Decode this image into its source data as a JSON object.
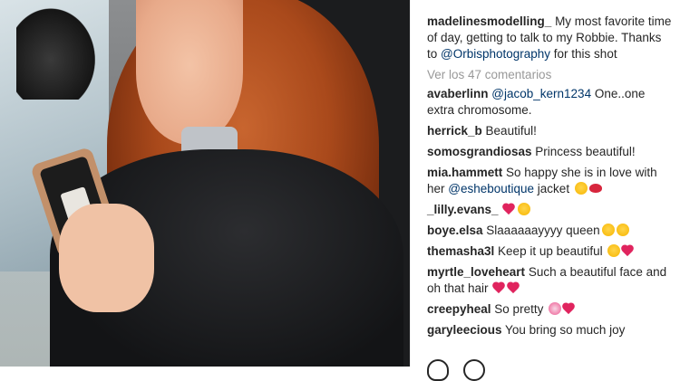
{
  "post": {
    "author": "madelinesmodelling_",
    "caption_pre": "My most favorite time of day, getting to talk to my Robbie. Thanks to ",
    "caption_mention": "@Orbisphotography",
    "caption_post": " for this shot"
  },
  "view_all_comments": "Ver los 47 comentarios",
  "comments": [
    {
      "user": "avaberlinn",
      "mention": "@jacob_kern1234",
      "text": " One..one extra chromosome.",
      "emojis": []
    },
    {
      "user": "herrick_b",
      "mention": "",
      "text": " Beautiful!",
      "emojis": []
    },
    {
      "user": "somosgrandiosas",
      "mention": "",
      "text": " Princess beautiful!",
      "emojis": []
    },
    {
      "user": "mia.hammett",
      "mention_prefix": " So happy she is in love with her ",
      "mention": "@esheboutique",
      "text": " jacket",
      "emojis": [
        "face-kiss",
        "lips"
      ]
    },
    {
      "user": "_lilly.evans_",
      "mention": "",
      "text": "",
      "emojis": [
        "heart",
        "face-heart"
      ]
    },
    {
      "user": "boye.elsa",
      "mention": "",
      "text": " Slaaaaaayyyy queen",
      "emojis": [
        "face-heart",
        "face-heart"
      ]
    },
    {
      "user": "themasha3l",
      "mention": "",
      "text": " Keep it up beautiful",
      "emojis": [
        "face-heart",
        "heart"
      ]
    },
    {
      "user": "myrtle_loveheart",
      "mention": "",
      "text": " Such a beautiful face and oh that hair",
      "emojis": [
        "heart",
        "heart"
      ]
    },
    {
      "user": "creepyheal",
      "mention": "",
      "text": " So pretty",
      "emojis": [
        "flower",
        "heart"
      ]
    },
    {
      "user": "garyleecious",
      "mention": "",
      "text": " You bring so much joy",
      "emojis": []
    }
  ],
  "icons": {
    "like": "heart-outline-icon",
    "comment": "speech-bubble-icon"
  },
  "colors": {
    "username": "#262626",
    "mention": "#003569",
    "muted": "#999999"
  }
}
